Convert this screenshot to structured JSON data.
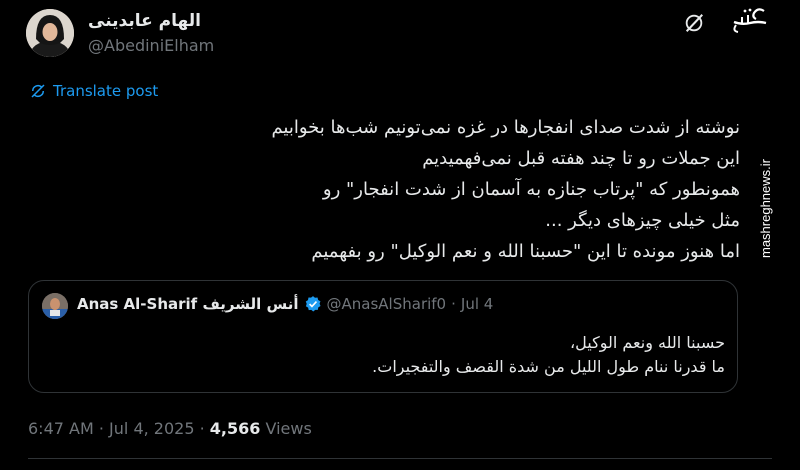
{
  "author": {
    "display_name": "الهام عابدینی",
    "handle": "@AbediniElham"
  },
  "watermark": {
    "logo_text": "مشرق",
    "url": "mashreghnews.ir"
  },
  "translate_label": "Translate post",
  "tweet_lines": [
    "نوشته از شدت صدای انفجارها در غزه نمی‌تونیم شب‌ها بخوابیم",
    "این جملات رو تا چند هفته قبل نمی‌فهمیدیم",
    "همونطور که \"پرتاب جنازه به آسمان از شدت انفجار\" رو",
    "مثل خیلی چیزهای دیگر ...",
    "اما هنوز مونده تا این \"حسبنا الله و نعم الوکیل\" رو بفهمیم"
  ],
  "quoted": {
    "name": "Anas Al-Sharif أنس الشريف",
    "handle": "@AnasAlSharif0",
    "separator": "·",
    "date": "Jul 4",
    "lines": [
      "حسبنا الله ونعم الوكيل،",
      "ما قدرنا ننام طول الليل من شدة القصف والتفجيرات."
    ]
  },
  "footer": {
    "time": "6:47 AM",
    "separator": "·",
    "date": "Jul 4, 2025",
    "views_count": "4,566",
    "views_label": "Views"
  },
  "colors": {
    "background": "#000000",
    "text": "#e7e9ea",
    "muted": "#71767b",
    "link": "#1d9bf0",
    "border": "#2f3336"
  },
  "icons": [
    "grok-icon",
    "translate-icon",
    "verified-badge-icon"
  ]
}
